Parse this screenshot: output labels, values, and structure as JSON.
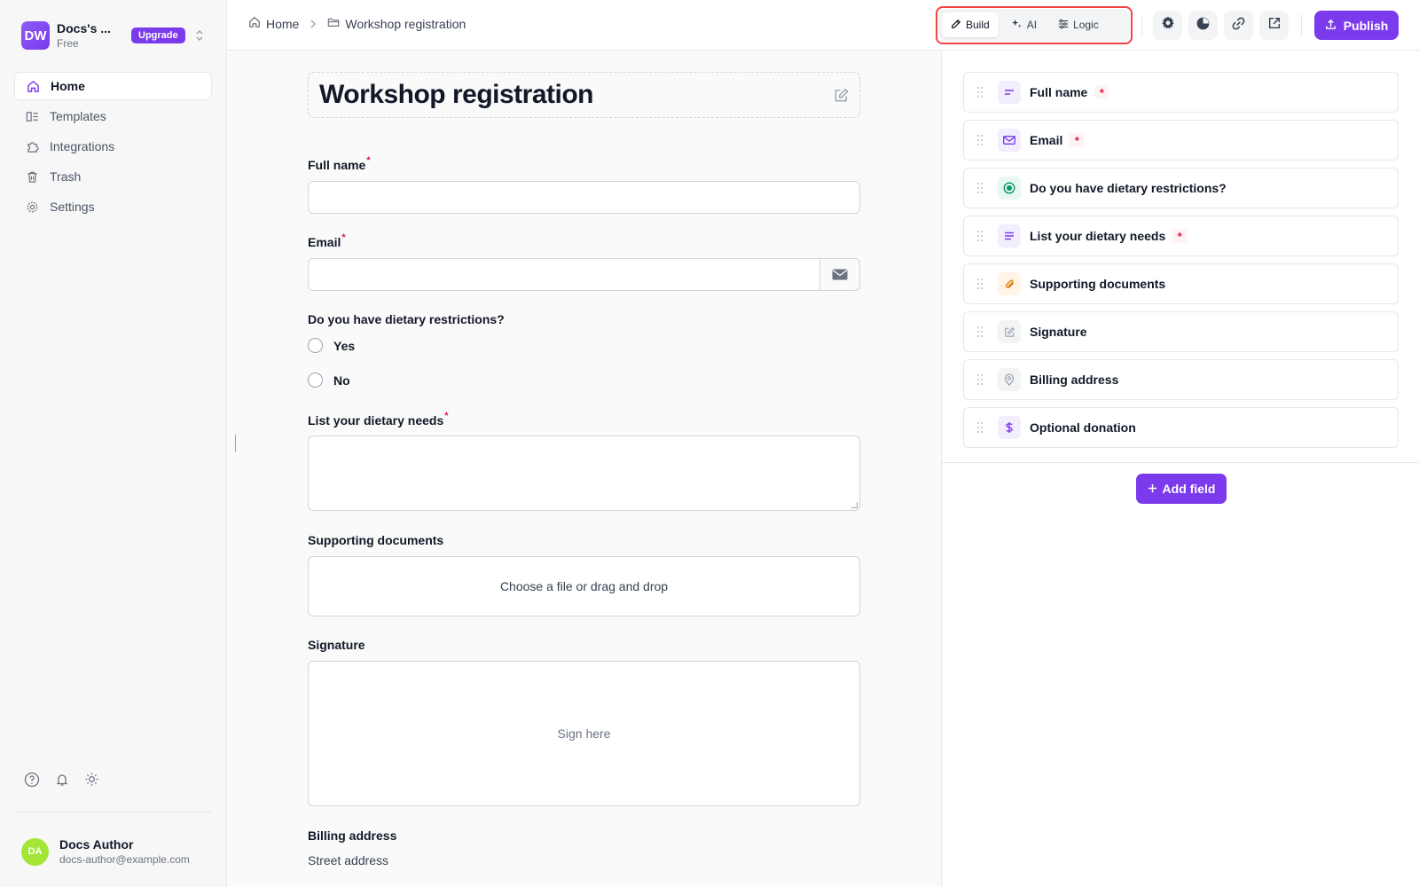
{
  "workspace": {
    "initials": "DW",
    "name": "Docs's ...",
    "plan": "Free",
    "upgrade_label": "Upgrade"
  },
  "nav": [
    {
      "label": "Home",
      "icon": "home-icon",
      "active": true
    },
    {
      "label": "Templates",
      "icon": "templates-icon"
    },
    {
      "label": "Integrations",
      "icon": "puzzle-icon"
    },
    {
      "label": "Trash",
      "icon": "trash-icon"
    },
    {
      "label": "Settings",
      "icon": "gear-icon"
    }
  ],
  "user": {
    "initials": "DA",
    "name": "Docs Author",
    "email": "docs-author@example.com"
  },
  "breadcrumb": {
    "home": "Home",
    "current": "Workshop registration"
  },
  "modes": [
    {
      "label": "Build",
      "icon": "edit-icon",
      "active": true
    },
    {
      "label": "AI",
      "icon": "sparkle-icon"
    },
    {
      "label": "Logic",
      "icon": "sliders-icon"
    }
  ],
  "toolbar": {
    "publish_label": "Publish"
  },
  "form": {
    "title": "Workshop registration",
    "full_name_label": "Full name",
    "email_label": "Email",
    "dietary_label": "Do you have dietary restrictions?",
    "dietary_options": [
      "Yes",
      "No"
    ],
    "dietary_needs_label": "List your dietary needs",
    "supporting_docs_label": "Supporting documents",
    "dropzone_text": "Choose a file or drag and drop",
    "signature_label": "Signature",
    "signature_placeholder": "Sign here",
    "billing_label": "Billing address",
    "street_label": "Street address",
    "required_mark": "*"
  },
  "fields": [
    {
      "label": "Full name",
      "icon": "short-text-icon",
      "required": true
    },
    {
      "label": "Email",
      "icon": "mail-icon",
      "required": true
    },
    {
      "label": "Do you have dietary restrictions?",
      "icon": "radio-icon",
      "required": false
    },
    {
      "label": "List your dietary needs",
      "icon": "long-text-icon",
      "required": true
    },
    {
      "label": "Supporting documents",
      "icon": "paperclip-icon",
      "required": false
    },
    {
      "label": "Signature",
      "icon": "signature-icon",
      "required": false
    },
    {
      "label": "Billing address",
      "icon": "location-pin-icon",
      "required": false
    },
    {
      "label": "Optional donation",
      "icon": "dollar-icon",
      "required": false
    }
  ],
  "add_field_label": "Add field",
  "colors": {
    "accent": "#7c3aed",
    "required": "#e11d48",
    "highlight": "#ef4444"
  }
}
